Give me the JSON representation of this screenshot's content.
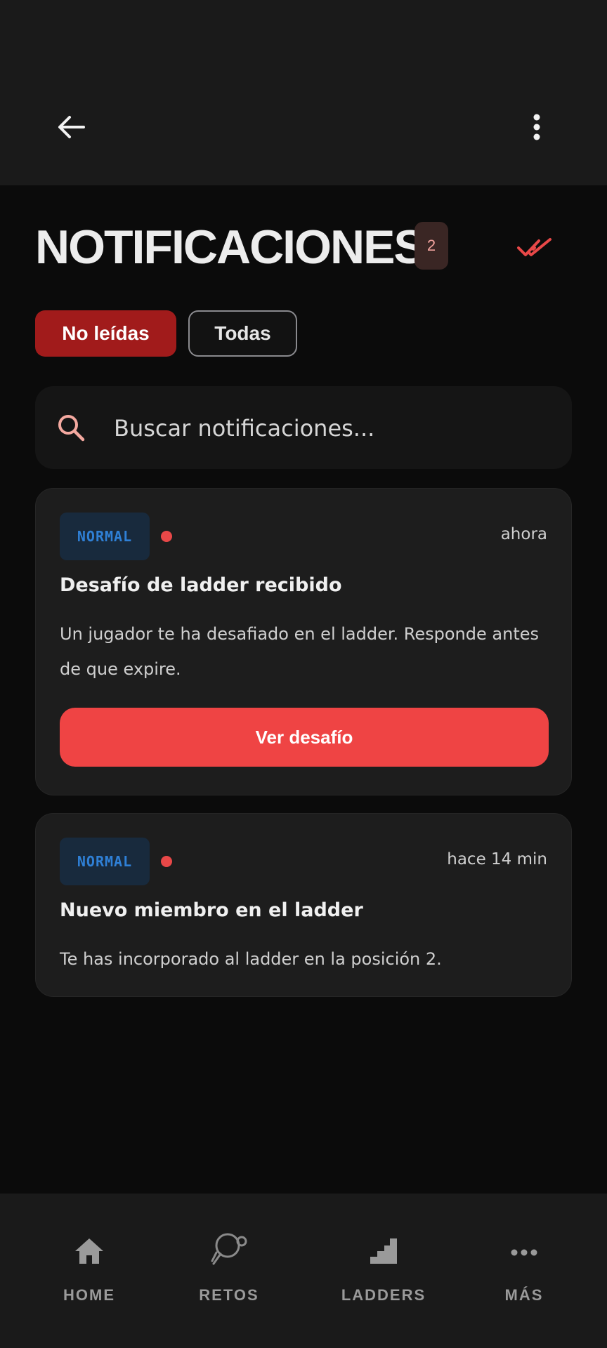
{
  "header": {
    "title": "NOTIFICACIONES",
    "unread_count": "2"
  },
  "filters": [
    {
      "label": "No leídas",
      "active": true
    },
    {
      "label": "Todas",
      "active": false
    }
  ],
  "search": {
    "placeholder": "Buscar notificaciones...",
    "value": ""
  },
  "notifications": [
    {
      "priority": "NORMAL",
      "unread": true,
      "time": "ahora",
      "title": "Desafío de ladder recibido",
      "body": "Un jugador te ha desafiado en el ladder. Responde antes de que expire.",
      "action_label": "Ver desafío"
    },
    {
      "priority": "NORMAL",
      "unread": true,
      "time": "hace 14 min",
      "title": "Nuevo miembro en el ladder",
      "body": "Te has incorporado al ladder en la posición 2."
    }
  ],
  "bottom_nav": [
    {
      "label": "HOME",
      "icon": "home-icon"
    },
    {
      "label": "RETOS",
      "icon": "ping-pong-paddle-icon"
    },
    {
      "label": "LADDERS",
      "icon": "stairs-icon"
    },
    {
      "label": "MÁS",
      "icon": "more-dots-icon"
    }
  ],
  "colors": {
    "accent": "#ef4444",
    "chip_active": "#a11b1b",
    "priority_text": "#2f80d6",
    "background": "#0b0b0b"
  }
}
